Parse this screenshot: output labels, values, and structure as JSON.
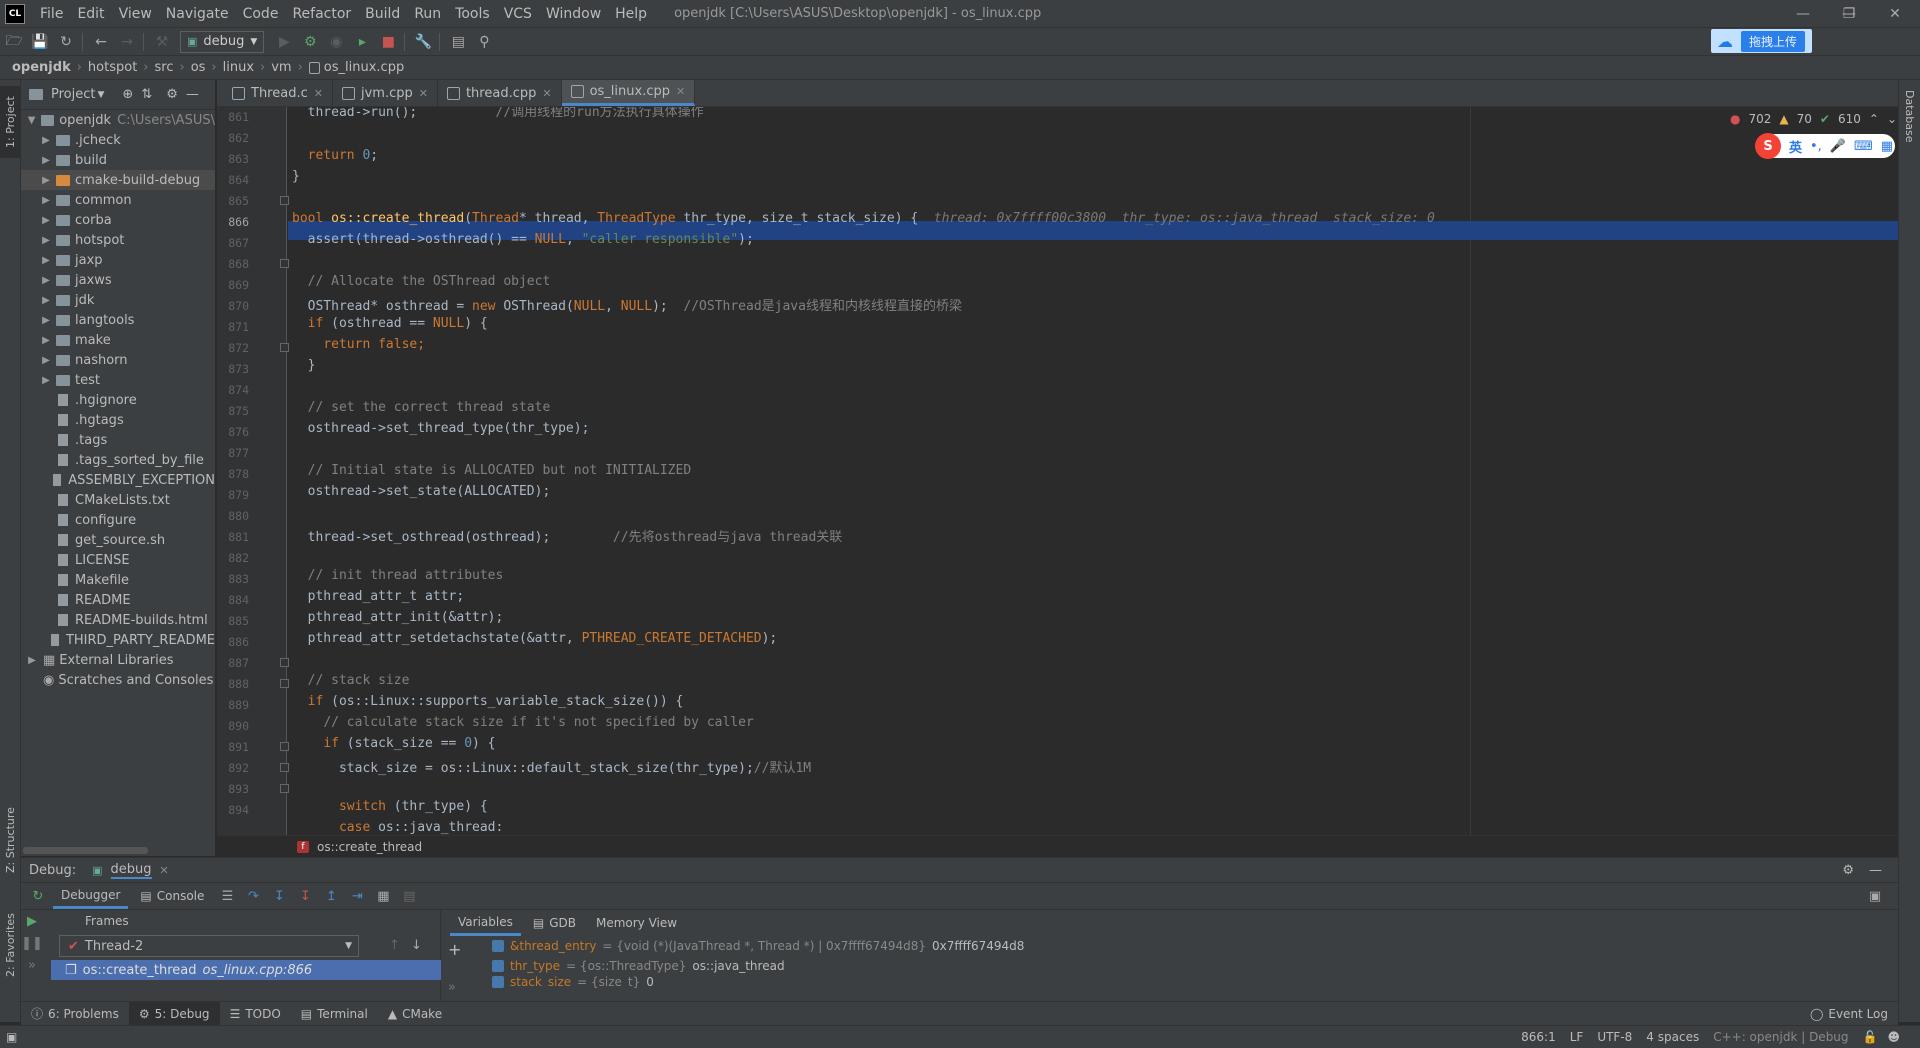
{
  "window": {
    "title": "openjdk [C:\\Users\\ASUS\\Desktop\\openjdk] - os_linux.cpp",
    "logo": "CL"
  },
  "menu": [
    "File",
    "Edit",
    "View",
    "Navigate",
    "Code",
    "Refactor",
    "Build",
    "Run",
    "Tools",
    "VCS",
    "Window",
    "Help"
  ],
  "toolbar": {
    "run_config": "debug",
    "upload_button": "拖拽上传"
  },
  "breadcrumbs": [
    "openjdk",
    "hotspot",
    "src",
    "os",
    "linux",
    "vm",
    "os_linux.cpp"
  ],
  "project": {
    "title": "Project",
    "root": "openjdk",
    "root_path": "C:\\Users\\ASUS\\",
    "folders": [
      ".jcheck",
      "build",
      "cmake-build-debug",
      "common",
      "corba",
      "hotspot",
      "jaxp",
      "jaxws",
      "jdk",
      "langtools",
      "make",
      "nashorn",
      "test"
    ],
    "files": [
      ".hgignore",
      ".hgtags",
      ".tags",
      ".tags_sorted_by_file",
      "ASSEMBLY_EXCEPTION",
      "CMakeLists.txt",
      "configure",
      "get_source.sh",
      "LICENSE",
      "Makefile",
      "README",
      "README-builds.html",
      "THIRD_PARTY_README"
    ],
    "external": "External Libraries",
    "scratches": "Scratches and Consoles"
  },
  "side_tabs": {
    "project": "1: Project",
    "structure": "Z: Structure",
    "favorites": "2: Favorites",
    "database": "Database"
  },
  "editor_tabs": [
    "Thread.c",
    "jvm.cpp",
    "thread.cpp",
    "os_linux.cpp"
  ],
  "inspections": {
    "errors": "702",
    "warnings": "70",
    "ok": "610"
  },
  "ime": {
    "lang": "英",
    "punct": "•,",
    "s": "S"
  },
  "editor": {
    "lines": [
      "861",
      "862",
      "863",
      "864",
      "865",
      "866",
      "867",
      "868",
      "869",
      "870",
      "871",
      "872",
      "873",
      "874",
      "875",
      "876",
      "877",
      "878",
      "879",
      "880",
      "881",
      "882",
      "883",
      "884",
      "885",
      "886",
      "887",
      "888",
      "889",
      "890",
      "891",
      "892",
      "893",
      "894"
    ],
    "partial": "thread->run();",
    "partial_cm": "//调用线程的run方法执行具体操作",
    "return_kw": "return",
    "zero": "0",
    "sig_kw": "bool",
    "sig_name": "os::create_thread",
    "sig_p1t": "Thread",
    "sig_p1": "* thread, ",
    "sig_p2t": "ThreadType",
    "sig_p2": " thr_type, size_t stack_size) {",
    "hint": "thread: 0x7ffff00c3800  thr_type: os::java_thread  stack_size: 0",
    "assert_a": "assert(thread->osthread() == ",
    "assert_null": "NULL",
    "assert_str": "\"caller responsible\"",
    "c868": "// Allocate the OSThread object",
    "l869a": "OSThread* osthread = ",
    "l869new": "new",
    "l869b": " OSThread(",
    "l869c": "NULL",
    "l869d": ", ",
    "l869e": "NULL",
    "l869f": ");",
    "l869cm": "//OSThread是java线程和内核线程直接的桥梁",
    "l870a": "if",
    "l870b": " (osthread == ",
    "l870c": "NULL",
    "l870d": ") {",
    "l871": "return false;",
    "c874": "// set the correct thread state",
    "l875": "osthread->set_thread_type(thr_type);",
    "c877": "// Initial state is ALLOCATED but not INITIALIZED",
    "l878": "osthread->set_state(ALLOCATED);",
    "l880": "thread->set_osthread(osthread);",
    "l880cm": "//先将osthread与java thread关联",
    "c882": "// init thread attributes",
    "l883": "pthread_attr_t attr;",
    "l884": "pthread_attr_init(&attr);",
    "l885a": "pthread_attr_setdetachstate(&attr, ",
    "l885b": "PTHREAD_CREATE_DETACHED",
    "l885c": ");",
    "c887": "// stack size",
    "l888a": "if",
    "l888b": " (os::Linux::supports_variable_stack_size()) {",
    "c889": "// calculate stack size if it's not specified by caller",
    "l890a": "if",
    "l890b": " (stack_size == ",
    "l890c": "0",
    "l890d": ") {",
    "l891": "stack_size = os::Linux::default_stack_size(thr_type);",
    "l891cm": "//默认1M",
    "l893a": "switch",
    "l893b": " (thr_type) {",
    "l894a": "case",
    "l894b": " os::java_thread:"
  },
  "editor_crumb": "os::create_thread",
  "debug": {
    "title": "Debug:",
    "config": "debug",
    "tabs": [
      "Debugger",
      "Console"
    ],
    "frames_title": "Frames",
    "thread": "Thread-2",
    "frame": "os::create_thread",
    "frame_loc": "os_linux.cpp:866",
    "var_tabs": [
      "Variables",
      "GDB",
      "Memory View"
    ],
    "vars": [
      {
        "name": "&thread_entry",
        "type": " = {void (*)(JavaThread *, Thread *) | 0x7ffff67494d8}",
        "value": " 0x7ffff67494d8"
      },
      {
        "name": "thr_type",
        "type": " = {os::ThreadType}",
        "value": " os::java_thread"
      },
      {
        "name": "stack_size",
        "type": " = {size_t}",
        "value": " 0"
      }
    ]
  },
  "bottom_tabs": [
    "6: Problems",
    "5: Debug",
    "TODO",
    "Terminal",
    "CMake"
  ],
  "event_log": "Event Log",
  "status": {
    "pos": "866:1",
    "lf": "LF",
    "enc": "UTF-8",
    "indent": "4 spaces",
    "ctx": "C++: openjdk | Debug"
  }
}
